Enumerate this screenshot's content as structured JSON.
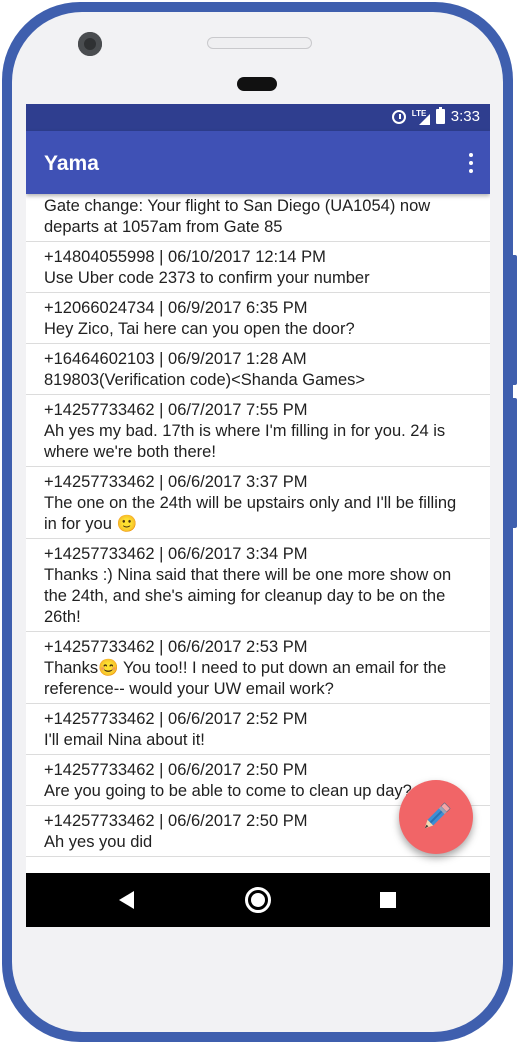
{
  "status_bar": {
    "time": "3:33",
    "icons": [
      "alarm-icon",
      "lte-signal-icon",
      "battery-icon"
    ]
  },
  "app_bar": {
    "title": "Yama",
    "overflow_icon": "more-vert-icon"
  },
  "messages": [
    {
      "header": "",
      "body": "Gate change: Your flight to San Diego (UA1054) now departs at 1057am from Gate 85"
    },
    {
      "header": "+14804055998 | 06/10/2017 12:14 PM",
      "body": "Use Uber code 2373 to confirm your number"
    },
    {
      "header": "+12066024734 | 06/9/2017 6:35 PM",
      "body": "Hey Zico, Tai here can you open the door?"
    },
    {
      "header": "+16464602103 | 06/9/2017 1:28 AM",
      "body": "819803(Verification code)<Shanda Games>"
    },
    {
      "header": "+14257733462 | 06/7/2017 7:55 PM",
      "body": "Ah yes my bad. 17th is where I'm filling in for you. 24 is where we're both there!"
    },
    {
      "header": "+14257733462 | 06/6/2017 3:37 PM",
      "body": "The one on the 24th will be upstairs only and I'll be filling in for you 🙂"
    },
    {
      "header": "+14257733462 | 06/6/2017 3:34 PM",
      "body": "Thanks :) Nina said that there will be one more show on the 24th, and she's aiming for cleanup day to be on the 26th!"
    },
    {
      "header": "+14257733462 | 06/6/2017 2:53 PM",
      "body": "Thanks😊 You too!! I need to put down an email for the reference-- would your UW email work?"
    },
    {
      "header": "+14257733462 | 06/6/2017 2:52 PM",
      "body": "I'll email Nina about it!"
    },
    {
      "header": "+14257733462 | 06/6/2017 2:50 PM",
      "body": "Are you going to be able to come to clean up day?"
    },
    {
      "header": "+14257733462 | 06/6/2017 2:50 PM",
      "body": "Ah yes you did"
    }
  ],
  "fab": {
    "icon": "pencil-icon",
    "color": "#f16567"
  },
  "nav_bar": {
    "back": "back-icon",
    "home": "home-icon",
    "recents": "recents-icon"
  },
  "colors": {
    "primary": "#3f51b5",
    "primary_dark": "#2f3e8f",
    "frame": "#3f5fae"
  }
}
